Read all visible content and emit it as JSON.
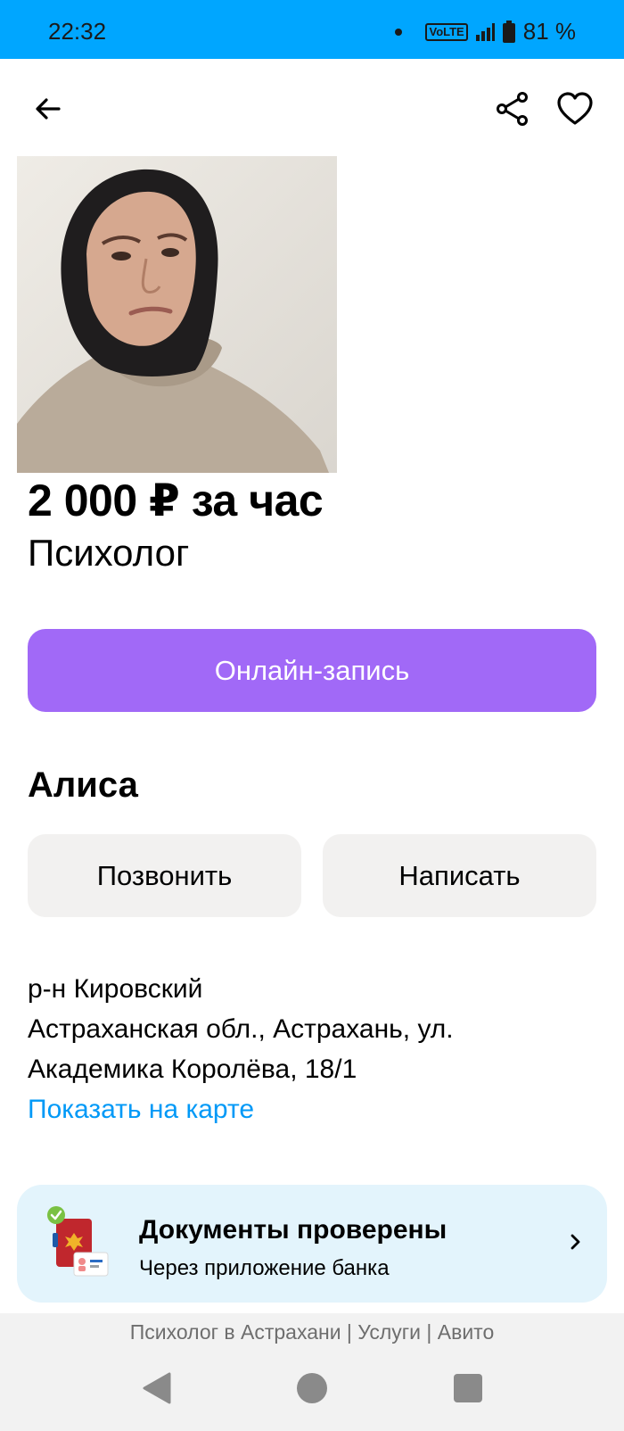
{
  "status": {
    "time": "22:32",
    "network": "VoLTE",
    "battery": "81 %"
  },
  "listing": {
    "price": "2 000 ₽ за час",
    "title": "Психолог",
    "book_label": "Онлайн-запись"
  },
  "seller": {
    "name": "Алиса",
    "call_label": "Позвонить",
    "message_label": "Написать"
  },
  "location": {
    "district": "р-н Кировский",
    "address_line1": "Астраханская обл., Астрахань, ул.",
    "address_line2": "Академика Королёва, 18/1",
    "map_link": "Показать на карте"
  },
  "verification": {
    "title": "Документы проверены",
    "subtitle": "Через приложение банка"
  },
  "footer": {
    "caption": "Психолог в Астрахани | Услуги | Авито"
  },
  "icons": {
    "back": "arrow-left-icon",
    "share": "share-icon",
    "favorite": "heart-icon",
    "verified": "check-badge-icon",
    "chevron": "chevron-right-icon"
  },
  "colors": {
    "status_bar": "#00a6ff",
    "primary_button": "#a169f7",
    "secondary_button": "#f2f1f0",
    "link": "#0099f7",
    "verify_card": "#e3f4fc"
  }
}
